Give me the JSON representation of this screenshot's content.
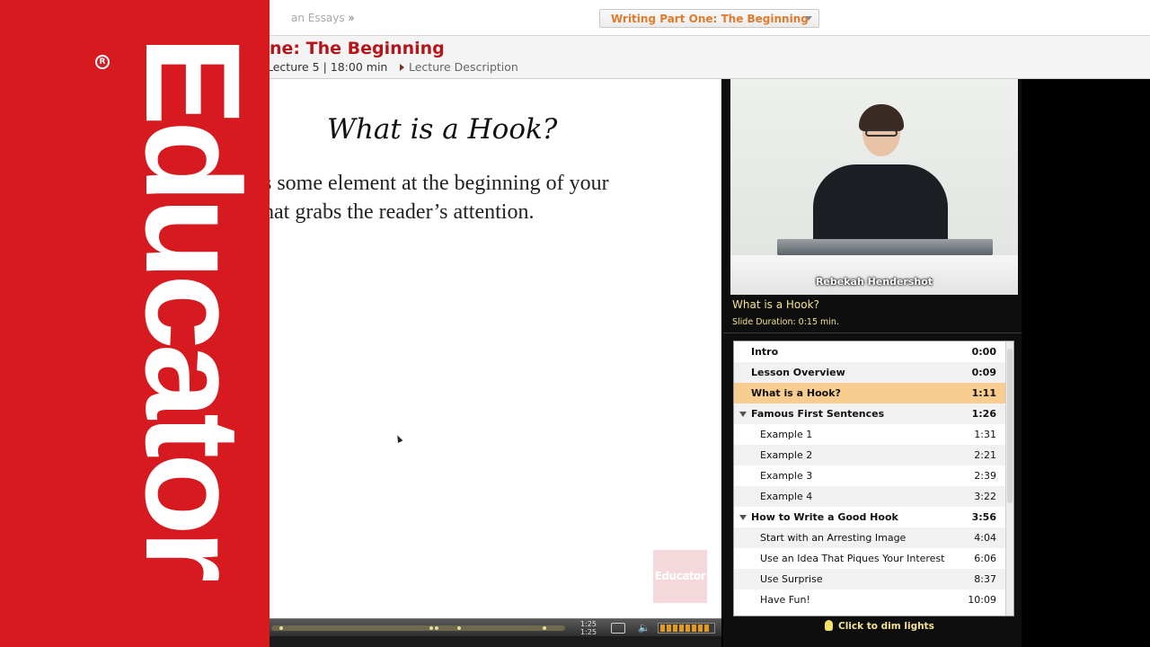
{
  "brand": {
    "name": "Educator",
    "registered_mark": "R"
  },
  "breadcrumb": {
    "parent": "an Essays",
    "separator": "»",
    "current": "Writing Part One: The Beginning"
  },
  "lesson": {
    "title": "ne: The Beginning",
    "meta": "Lecture 5 | 18:00 min",
    "description_link": "Lecture Description"
  },
  "slide": {
    "title": "What is a Hook?",
    "body_line1": "s some element at the beginning of your",
    "body_line2": "hat grabs the reader’s attention.",
    "watermark": "Educator"
  },
  "player": {
    "time_current": "1:25",
    "time_total": "1:25",
    "progress": 0.0
  },
  "video": {
    "presenter": "Rebekah Hendershot"
  },
  "current_slide": {
    "name": "What is a Hook?",
    "duration": "Slide Duration: 0:15 min."
  },
  "outline": [
    {
      "label": "Intro",
      "time": "0:00",
      "level": 0,
      "selected": false,
      "expander": false
    },
    {
      "label": "Lesson Overview",
      "time": "0:09",
      "level": 0,
      "selected": false,
      "expander": false
    },
    {
      "label": "What is a Hook?",
      "time": "1:11",
      "level": 0,
      "selected": true,
      "expander": false
    },
    {
      "label": "Famous First Sentences",
      "time": "1:26",
      "level": 0,
      "selected": false,
      "expander": true
    },
    {
      "label": "Example 1",
      "time": "1:31",
      "level": 1,
      "selected": false,
      "expander": false
    },
    {
      "label": "Example 2",
      "time": "2:21",
      "level": 1,
      "selected": false,
      "expander": false
    },
    {
      "label": "Example 3",
      "time": "2:39",
      "level": 1,
      "selected": false,
      "expander": false
    },
    {
      "label": "Example 4",
      "time": "3:22",
      "level": 1,
      "selected": false,
      "expander": false
    },
    {
      "label": "How to Write a Good Hook",
      "time": "3:56",
      "level": 0,
      "selected": false,
      "expander": true
    },
    {
      "label": "Start with an Arresting Image",
      "time": "4:04",
      "level": 1,
      "selected": false,
      "expander": false
    },
    {
      "label": "Use an Idea That Piques Your Interest",
      "time": "6:06",
      "level": 1,
      "selected": false,
      "expander": false
    },
    {
      "label": "Use Surprise",
      "time": "8:37",
      "level": 1,
      "selected": false,
      "expander": false
    },
    {
      "label": "Have Fun!",
      "time": "10:09",
      "level": 1,
      "selected": false,
      "expander": false
    }
  ],
  "dim_lights": "Click to dim lights",
  "colors": {
    "brand_red": "#d71920",
    "title_red": "#b5161c",
    "breadcrumb_orange": "#e07a2c",
    "selected_row": "#f8cd8f",
    "panel_text_yellow": "#f3e38f",
    "volume_orange": "#e49a1e"
  },
  "icons": [
    "expand-triangle-icon",
    "fullscreen-icon",
    "volume-icon",
    "lightbulb-icon",
    "dropdown-arrow-icon"
  ]
}
